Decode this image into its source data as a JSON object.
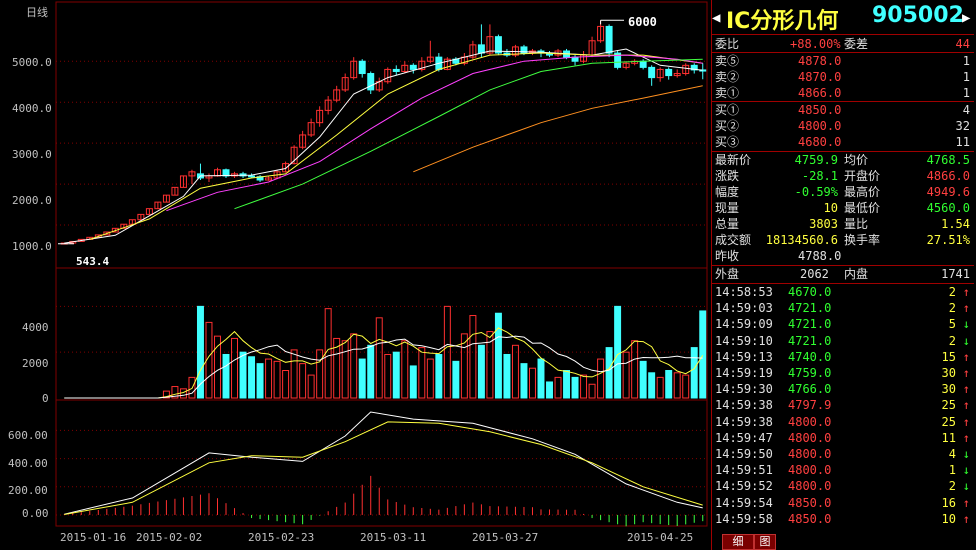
{
  "chart": {
    "period_label": "日线",
    "peak_label": "6000",
    "low_label": "543.4",
    "price_axis": [
      "5000.0",
      "4000.0",
      "3000.0",
      "2000.0",
      "1000.0"
    ],
    "volume_axis": [
      "4000",
      "2000",
      "0"
    ],
    "macd_axis": [
      "600.00",
      "400.00",
      "200.00",
      "0.00"
    ],
    "dates": [
      "2015-01-16",
      "2015-02-02",
      "2015-02-23",
      "2015-03-11",
      "2015-03-27",
      "2015-04-25"
    ],
    "colors": {
      "up": "#ff3030",
      "down": "#40ffff",
      "ma1": "#ffffff",
      "ma2": "#ffff40",
      "ma3": "#ff40ff",
      "ma4": "#40ff40",
      "ma5": "#ff9020",
      "grid": "#800000"
    }
  },
  "chart_data": {
    "type": "candlestick",
    "price_ylim": [
      0,
      6300
    ],
    "candles": [
      [
        543,
        560,
        540,
        560
      ],
      [
        560,
        600,
        555,
        600
      ],
      [
        600,
        650,
        598,
        650
      ],
      [
        650,
        700,
        648,
        700
      ],
      [
        700,
        760,
        698,
        760
      ],
      [
        760,
        830,
        758,
        830
      ],
      [
        830,
        920,
        828,
        920
      ],
      [
        920,
        1020,
        918,
        1020
      ],
      [
        1020,
        1130,
        1018,
        1130
      ],
      [
        1130,
        1260,
        1128,
        1260
      ],
      [
        1260,
        1400,
        1258,
        1400
      ],
      [
        1400,
        1560,
        1398,
        1560
      ],
      [
        1560,
        1730,
        1558,
        1730
      ],
      [
        1730,
        1920,
        1728,
        1920
      ],
      [
        1920,
        2200,
        1918,
        2200
      ],
      [
        2200,
        2300,
        2000,
        2350
      ],
      [
        2250,
        2150,
        2100,
        2500
      ],
      [
        2150,
        2200,
        2050,
        2260
      ],
      [
        2200,
        2350,
        2180,
        2400
      ],
      [
        2350,
        2200,
        2150,
        2380
      ],
      [
        2200,
        2250,
        2150,
        2300
      ],
      [
        2250,
        2200,
        2150,
        2300
      ],
      [
        2200,
        2180,
        2150,
        2260
      ],
      [
        2180,
        2100,
        2050,
        2220
      ],
      [
        2100,
        2150,
        2080,
        2200
      ],
      [
        2150,
        2300,
        2120,
        2350
      ],
      [
        2300,
        2500,
        2280,
        2550
      ],
      [
        2500,
        2900,
        2480,
        2950
      ],
      [
        2900,
        3200,
        2850,
        3300
      ],
      [
        3200,
        3500,
        3150,
        3600
      ],
      [
        3500,
        3800,
        3400,
        3900
      ],
      [
        3800,
        4050,
        3700,
        4150
      ],
      [
        4050,
        4300,
        4000,
        4400
      ],
      [
        4300,
        4600,
        4250,
        4700
      ],
      [
        4600,
        5000,
        4550,
        5100
      ],
      [
        5000,
        4700,
        4600,
        5050
      ],
      [
        4700,
        4300,
        4200,
        4750
      ],
      [
        4300,
        4500,
        4250,
        4600
      ],
      [
        4500,
        4800,
        4450,
        4850
      ],
      [
        4800,
        4750,
        4650,
        4900
      ],
      [
        4750,
        4900,
        4700,
        5000
      ],
      [
        4900,
        4800,
        4700,
        4950
      ],
      [
        4800,
        5000,
        4750,
        5100
      ],
      [
        5000,
        5100,
        4950,
        5500
      ],
      [
        5100,
        4800,
        4750,
        5200
      ],
      [
        4800,
        5050,
        4780,
        5100
      ],
      [
        5050,
        4950,
        4900,
        5100
      ],
      [
        4950,
        5100,
        4900,
        5200
      ],
      [
        5100,
        5400,
        5050,
        5500
      ],
      [
        5400,
        5200,
        5100,
        5900
      ],
      [
        5200,
        5600,
        5150,
        5900
      ],
      [
        5600,
        5200,
        5150,
        5650
      ],
      [
        5200,
        5150,
        5100,
        5300
      ],
      [
        5150,
        5350,
        5100,
        5400
      ],
      [
        5350,
        5200,
        5150,
        5400
      ],
      [
        5200,
        5250,
        5150,
        5300
      ],
      [
        5250,
        5200,
        5100,
        5300
      ],
      [
        5200,
        5150,
        5100,
        5250
      ],
      [
        5150,
        5250,
        5100,
        5300
      ],
      [
        5250,
        5100,
        5050,
        5300
      ],
      [
        5100,
        5000,
        4900,
        5150
      ],
      [
        5000,
        5150,
        4950,
        5250
      ],
      [
        5150,
        5500,
        5100,
        5600
      ],
      [
        5500,
        5850,
        5450,
        6000
      ],
      [
        5850,
        5200,
        5100,
        5900
      ],
      [
        5200,
        4850,
        4800,
        5250
      ],
      [
        4850,
        4950,
        4800,
        5000
      ],
      [
        4950,
        5000,
        4900,
        5050
      ],
      [
        5000,
        4850,
        4800,
        5050
      ],
      [
        4850,
        4600,
        4400,
        4900
      ],
      [
        4600,
        4800,
        4500,
        4850
      ],
      [
        4800,
        4650,
        4550,
        4850
      ],
      [
        4650,
        4700,
        4600,
        4800
      ],
      [
        4700,
        4900,
        4650,
        4950
      ],
      [
        4900,
        4788,
        4700,
        4950
      ],
      [
        4788,
        4760,
        4560,
        4950
      ]
    ],
    "ma_lines": {
      "ma5": [
        [
          0,
          560
        ],
        [
          6,
          750
        ],
        [
          14,
          1700
        ],
        [
          16,
          2200
        ],
        [
          22,
          2220
        ],
        [
          26,
          2380
        ],
        [
          30,
          3150
        ],
        [
          34,
          4200
        ],
        [
          38,
          4600
        ],
        [
          44,
          4950
        ],
        [
          50,
          5250
        ],
        [
          56,
          5220
        ],
        [
          62,
          5150
        ],
        [
          66,
          5300
        ],
        [
          70,
          4900
        ],
        [
          75,
          4780
        ]
      ],
      "ma10": [
        [
          3,
          650
        ],
        [
          10,
          1150
        ],
        [
          16,
          1900
        ],
        [
          22,
          2150
        ],
        [
          26,
          2250
        ],
        [
          32,
          3200
        ],
        [
          38,
          4200
        ],
        [
          44,
          4800
        ],
        [
          50,
          5150
        ],
        [
          56,
          5200
        ],
        [
          62,
          5150
        ],
        [
          68,
          5150
        ],
        [
          75,
          4950
        ]
      ],
      "ma20": [
        [
          12,
          1350
        ],
        [
          18,
          1800
        ],
        [
          24,
          2050
        ],
        [
          30,
          2550
        ],
        [
          36,
          3350
        ],
        [
          42,
          4100
        ],
        [
          48,
          4700
        ],
        [
          54,
          5000
        ],
        [
          60,
          5100
        ],
        [
          66,
          5150
        ],
        [
          72,
          5050
        ],
        [
          75,
          4950
        ]
      ],
      "ma30": [
        [
          20,
          1400
        ],
        [
          28,
          2000
        ],
        [
          36,
          2800
        ],
        [
          44,
          3650
        ],
        [
          50,
          4300
        ],
        [
          56,
          4750
        ],
        [
          62,
          4950
        ],
        [
          68,
          5000
        ],
        [
          75,
          5050
        ]
      ],
      "ma60": [
        [
          41,
          2300
        ],
        [
          48,
          2900
        ],
        [
          56,
          3500
        ],
        [
          62,
          3850
        ],
        [
          68,
          4100
        ],
        [
          75,
          4400
        ]
      ]
    },
    "volume": [
      0,
      0,
      0,
      0,
      0,
      0,
      0,
      0,
      0,
      0,
      0,
      0,
      300,
      500,
      400,
      900,
      4000,
      3300,
      2700,
      1900,
      2600,
      2000,
      1800,
      1500,
      1700,
      1600,
      1200,
      2100,
      1500,
      1000,
      2100,
      3900,
      2600,
      2500,
      2800,
      1700,
      2300,
      3500,
      1900,
      2000,
      2500,
      1400,
      2200,
      1700,
      1900,
      4000,
      1600,
      2800,
      3600,
      2300,
      2900,
      3700,
      1900,
      2300,
      1500,
      1300,
      1700,
      700,
      900,
      1200,
      900,
      1000,
      600,
      1700,
      2200,
      4000,
      2000,
      2500,
      1600,
      1100,
      900,
      1200,
      1100,
      1000,
      2200,
      3800
    ],
    "volume_ylim": [
      0,
      5500
    ],
    "macd_dif": [
      [
        0,
        5
      ],
      [
        8,
        120
      ],
      [
        17,
        440
      ],
      [
        22,
        410
      ],
      [
        28,
        380
      ],
      [
        33,
        560
      ],
      [
        36,
        730
      ],
      [
        41,
        680
      ],
      [
        48,
        650
      ],
      [
        55,
        540
      ],
      [
        60,
        430
      ],
      [
        66,
        220
      ],
      [
        72,
        90
      ],
      [
        75,
        50
      ]
    ],
    "macd_dea": [
      [
        0,
        3
      ],
      [
        8,
        90
      ],
      [
        17,
        370
      ],
      [
        22,
        420
      ],
      [
        28,
        410
      ],
      [
        33,
        520
      ],
      [
        38,
        660
      ],
      [
        44,
        650
      ],
      [
        50,
        590
      ],
      [
        56,
        500
      ],
      [
        62,
        370
      ],
      [
        68,
        200
      ],
      [
        75,
        70
      ]
    ],
    "macd_ylim": [
      -50,
      780
    ]
  },
  "panel": {
    "title_left_arrow": "◀",
    "title_right_arrow": "▶",
    "name": "IC分形几何",
    "code": "905002",
    "weibi_label": "委比",
    "weibi_value": "+88.00%",
    "weicha_label": "委差",
    "weicha_value": "44",
    "sells": [
      {
        "label": "卖⑤",
        "price": "4878.0",
        "vol": "1"
      },
      {
        "label": "卖②",
        "price": "4870.0",
        "vol": "1"
      },
      {
        "label": "卖①",
        "price": "4866.0",
        "vol": "1"
      }
    ],
    "buys": [
      {
        "label": "买①",
        "price": "4850.0",
        "vol": "4"
      },
      {
        "label": "买②",
        "price": "4800.0",
        "vol": "32"
      },
      {
        "label": "买③",
        "price": "4680.0",
        "vol": "11"
      }
    ],
    "quote": [
      {
        "l1": "最新价",
        "v1": "4759.9",
        "c1": "c-green",
        "l2": "均价",
        "v2": "4768.5",
        "c2": "c-green"
      },
      {
        "l1": "涨跌",
        "v1": "-28.1",
        "c1": "c-green",
        "l2": "开盘价",
        "v2": "4866.0",
        "c2": "c-red"
      },
      {
        "l1": "幅度",
        "v1": "-0.59%",
        "c1": "c-green",
        "l2": "最高价",
        "v2": "4949.6",
        "c2": "c-red"
      },
      {
        "l1": "现量",
        "v1": "10",
        "c1": "c-yellow",
        "l2": "最低价",
        "v2": "4560.0",
        "c2": "c-green"
      },
      {
        "l1": "总量",
        "v1": "3803",
        "c1": "c-yellow",
        "l2": "量比",
        "v2": "1.54",
        "c2": "c-yellow"
      },
      {
        "l1": "成交额",
        "v1": "18134560.6",
        "c1": "c-yellow",
        "l2": "换手率",
        "v2": "27.51%",
        "c2": "c-yellow"
      }
    ],
    "prev_close_label": "昨收",
    "prev_close_value": "4788.0",
    "outer_label": "外盘",
    "outer_value": "2062",
    "inner_label": "内盘",
    "inner_value": "1741",
    "ticks": [
      {
        "time": "14:58:53",
        "price": "4670.0",
        "pc": "c-green",
        "vol": "2",
        "dir": "↑",
        "dc": "c-red"
      },
      {
        "time": "14:59:03",
        "price": "4721.0",
        "pc": "c-green",
        "vol": "2",
        "dir": "↑",
        "dc": "c-red"
      },
      {
        "time": "14:59:09",
        "price": "4721.0",
        "pc": "c-green",
        "vol": "5",
        "dir": "↓",
        "dc": "c-green"
      },
      {
        "time": "14:59:10",
        "price": "4721.0",
        "pc": "c-green",
        "vol": "2",
        "dir": "↓",
        "dc": "c-green"
      },
      {
        "time": "14:59:13",
        "price": "4740.0",
        "pc": "c-green",
        "vol": "15",
        "dir": "↑",
        "dc": "c-red"
      },
      {
        "time": "14:59:19",
        "price": "4759.0",
        "pc": "c-green",
        "vol": "30",
        "dir": "↑",
        "dc": "c-red"
      },
      {
        "time": "14:59:30",
        "price": "4766.0",
        "pc": "c-green",
        "vol": "30",
        "dir": "↑",
        "dc": "c-red"
      },
      {
        "time": "14:59:38",
        "price": "4797.9",
        "pc": "c-red",
        "vol": "25",
        "dir": "↑",
        "dc": "c-red"
      },
      {
        "time": "14:59:38",
        "price": "4800.0",
        "pc": "c-red",
        "vol": "25",
        "dir": "↑",
        "dc": "c-red"
      },
      {
        "time": "14:59:47",
        "price": "4800.0",
        "pc": "c-red",
        "vol": "11",
        "dir": "↑",
        "dc": "c-red"
      },
      {
        "time": "14:59:50",
        "price": "4800.0",
        "pc": "c-red",
        "vol": "4",
        "dir": "↓",
        "dc": "c-green"
      },
      {
        "time": "14:59:51",
        "price": "4800.0",
        "pc": "c-red",
        "vol": "1",
        "dir": "↓",
        "dc": "c-green"
      },
      {
        "time": "14:59:52",
        "price": "4800.0",
        "pc": "c-red",
        "vol": "2",
        "dir": "↓",
        "dc": "c-green"
      },
      {
        "time": "14:59:54",
        "price": "4850.0",
        "pc": "c-red",
        "vol": "16",
        "dir": "↑",
        "dc": "c-red"
      },
      {
        "time": "14:59:58",
        "price": "4850.0",
        "pc": "c-red",
        "vol": "10",
        "dir": "↑",
        "dc": "c-red"
      }
    ],
    "tab_detail": "细",
    "tab_chart": "图"
  }
}
